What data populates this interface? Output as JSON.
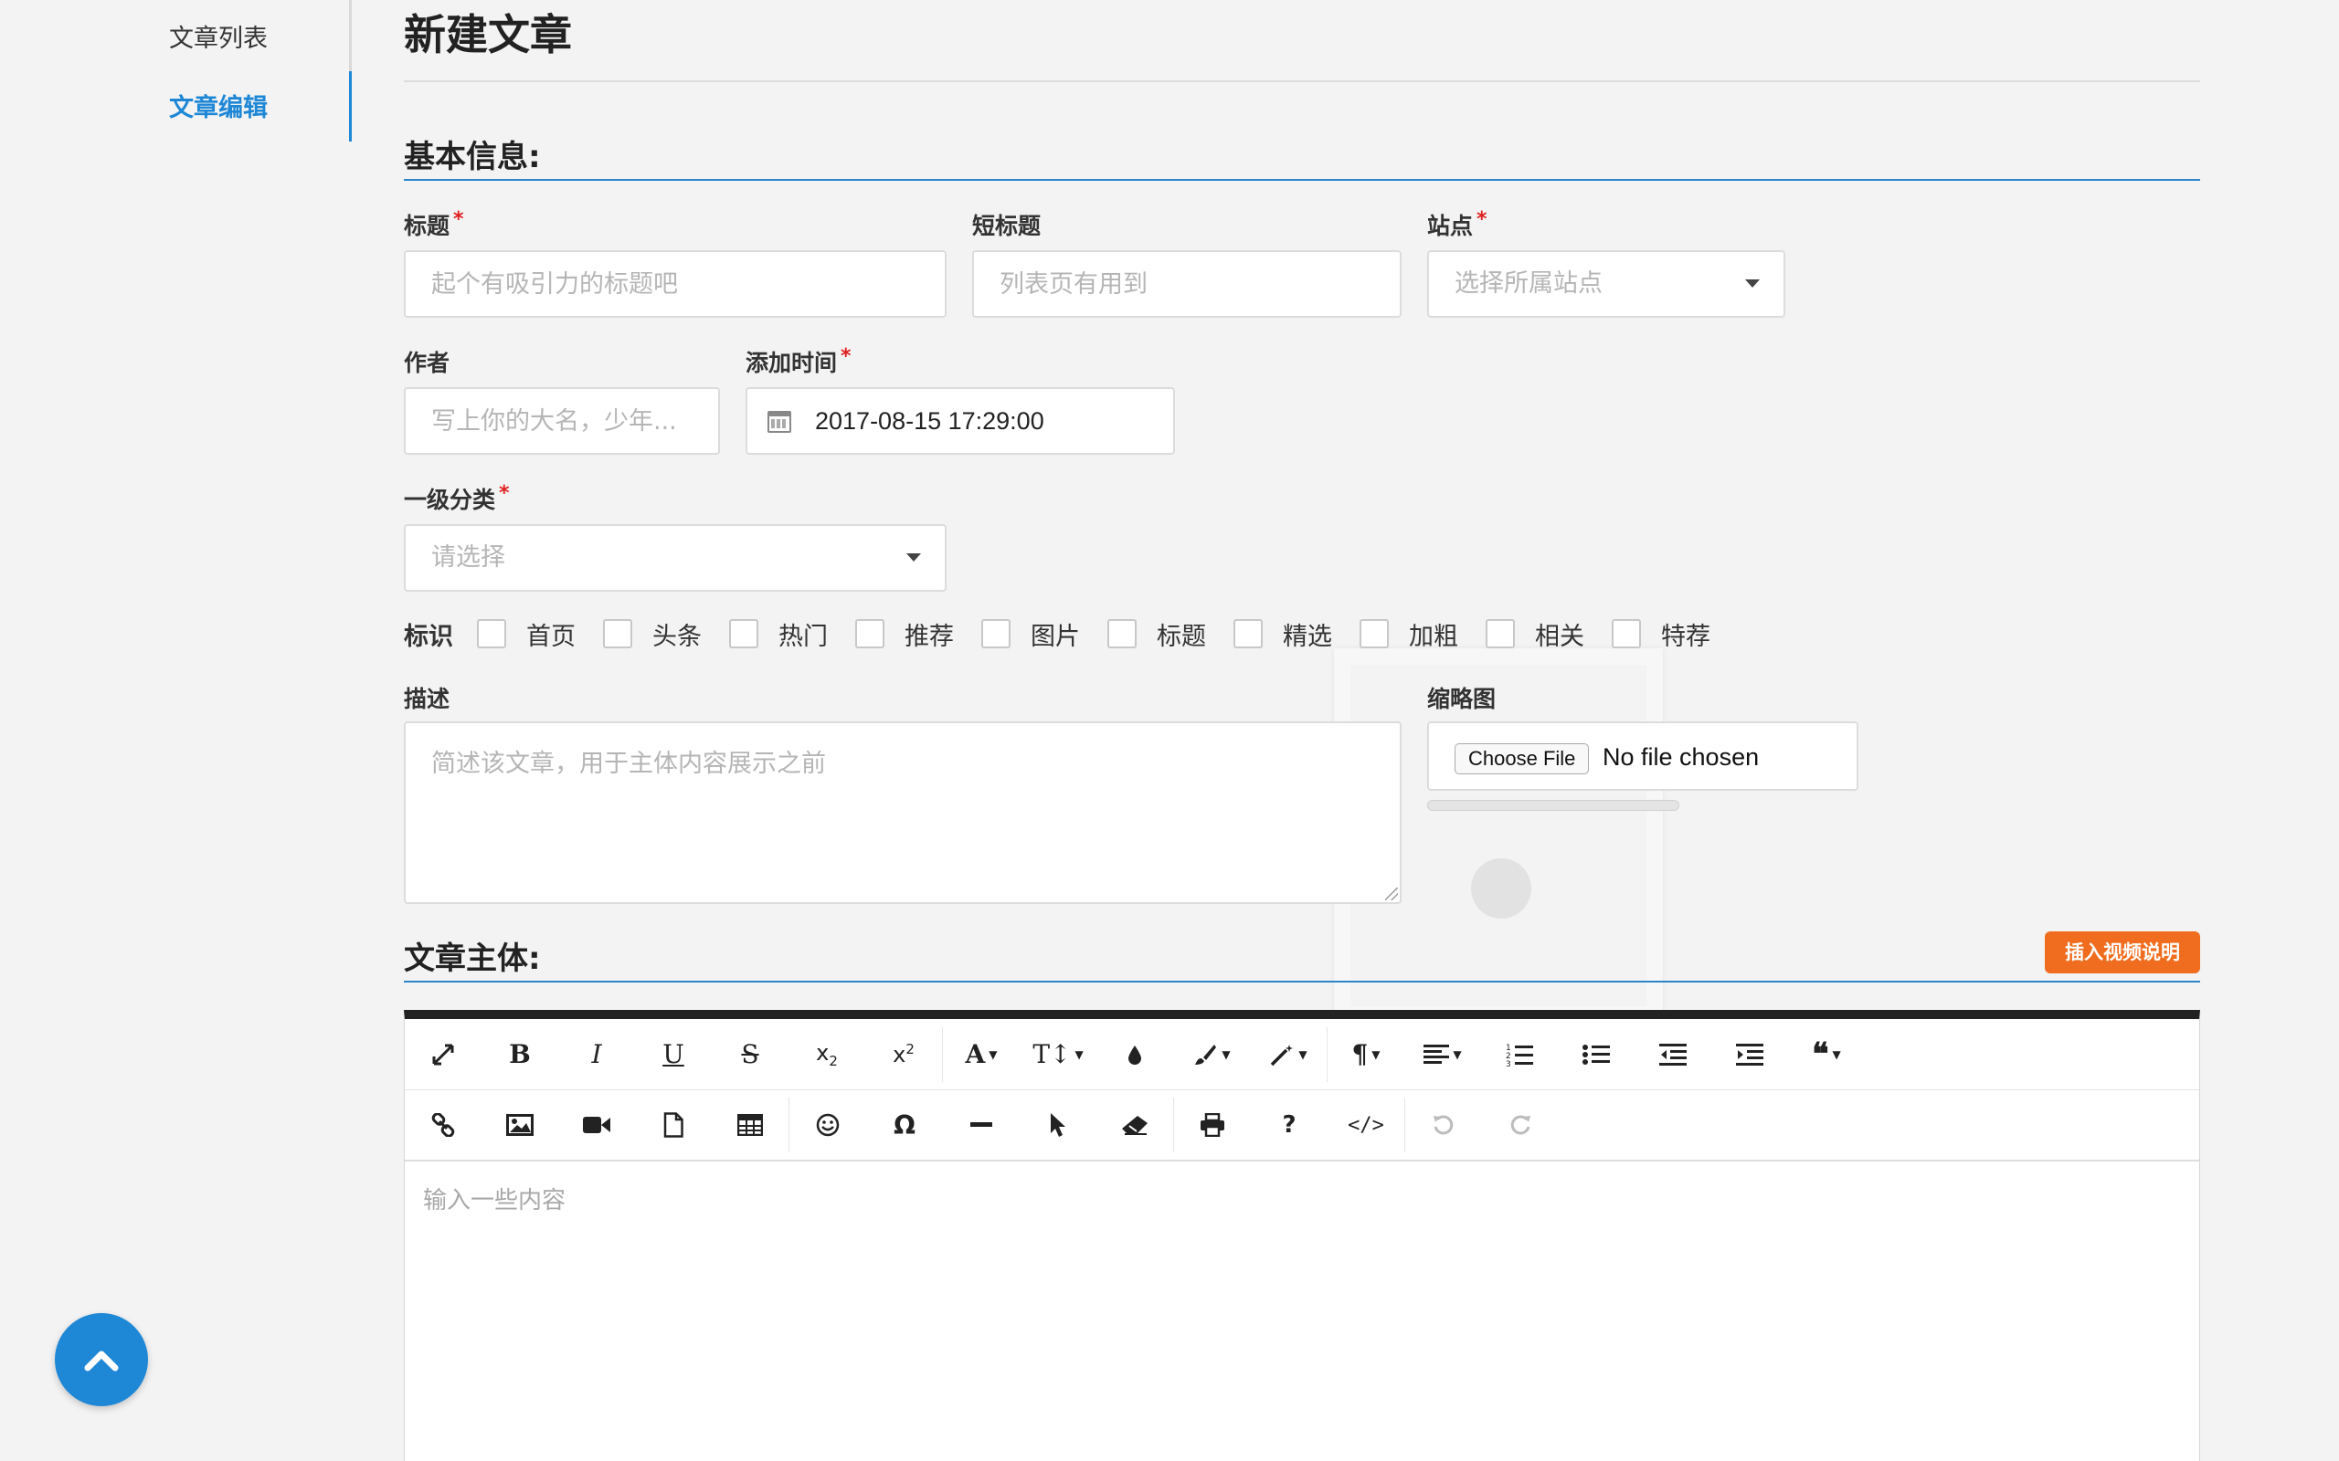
{
  "sidebar": {
    "items": [
      {
        "label": "文章列表",
        "active": false
      },
      {
        "label": "文章编辑",
        "active": true
      }
    ]
  },
  "page_title": "新建文章",
  "basic_section": {
    "title": "基本信息:"
  },
  "fields": {
    "title": {
      "label": "标题",
      "required": true,
      "placeholder": "起个有吸引力的标题吧"
    },
    "short_title": {
      "label": "短标题",
      "required": false,
      "placeholder": "列表页有用到"
    },
    "site": {
      "label": "站点",
      "required": true,
      "placeholder": "选择所属站点"
    },
    "author": {
      "label": "作者",
      "required": false,
      "placeholder": "写上你的大名，少年..."
    },
    "add_time": {
      "label": "添加时间",
      "required": true,
      "value": "2017-08-15 17:29:00"
    },
    "category": {
      "label": "一级分类",
      "required": true,
      "placeholder": "请选择"
    },
    "description": {
      "label": "描述",
      "placeholder": "简述该文章，用于主体内容展示之前"
    },
    "thumbnail": {
      "label": "缩略图",
      "button": "Choose File",
      "status": "No file chosen",
      "progress": 0
    }
  },
  "flags": {
    "title": "标识",
    "items": [
      "首页",
      "头条",
      "热门",
      "推荐",
      "图片",
      "标题",
      "精选",
      "加粗",
      "相关",
      "特荐"
    ]
  },
  "body_section": {
    "title": "文章主体:",
    "video_button": "插入视频说明"
  },
  "editor": {
    "placeholder": "输入一些内容",
    "toolbar_row1": [
      "fullscreen-icon",
      "bold-icon",
      "italic-icon",
      "underline-icon",
      "strikethrough-icon",
      "subscript-icon",
      "superscript-icon",
      "font-family-icon",
      "font-size-icon",
      "text-color-icon",
      "background-color-icon",
      "magic-format-icon",
      "paragraph-icon",
      "align-icon",
      "ordered-list-icon",
      "unordered-list-icon",
      "outdent-icon",
      "indent-icon",
      "quote-icon"
    ],
    "toolbar_row2": [
      "link-icon",
      "image-icon",
      "video-icon",
      "file-icon",
      "table-icon",
      "emoji-icon",
      "special-char-icon",
      "horizontal-rule-icon",
      "select-all-icon",
      "clear-format-icon",
      "print-icon",
      "help-icon",
      "code-view-icon",
      "undo-icon",
      "redo-icon"
    ]
  },
  "colors": {
    "accent": "#1e87d6",
    "video_button": "#f06d1f",
    "required": "#e02020"
  }
}
